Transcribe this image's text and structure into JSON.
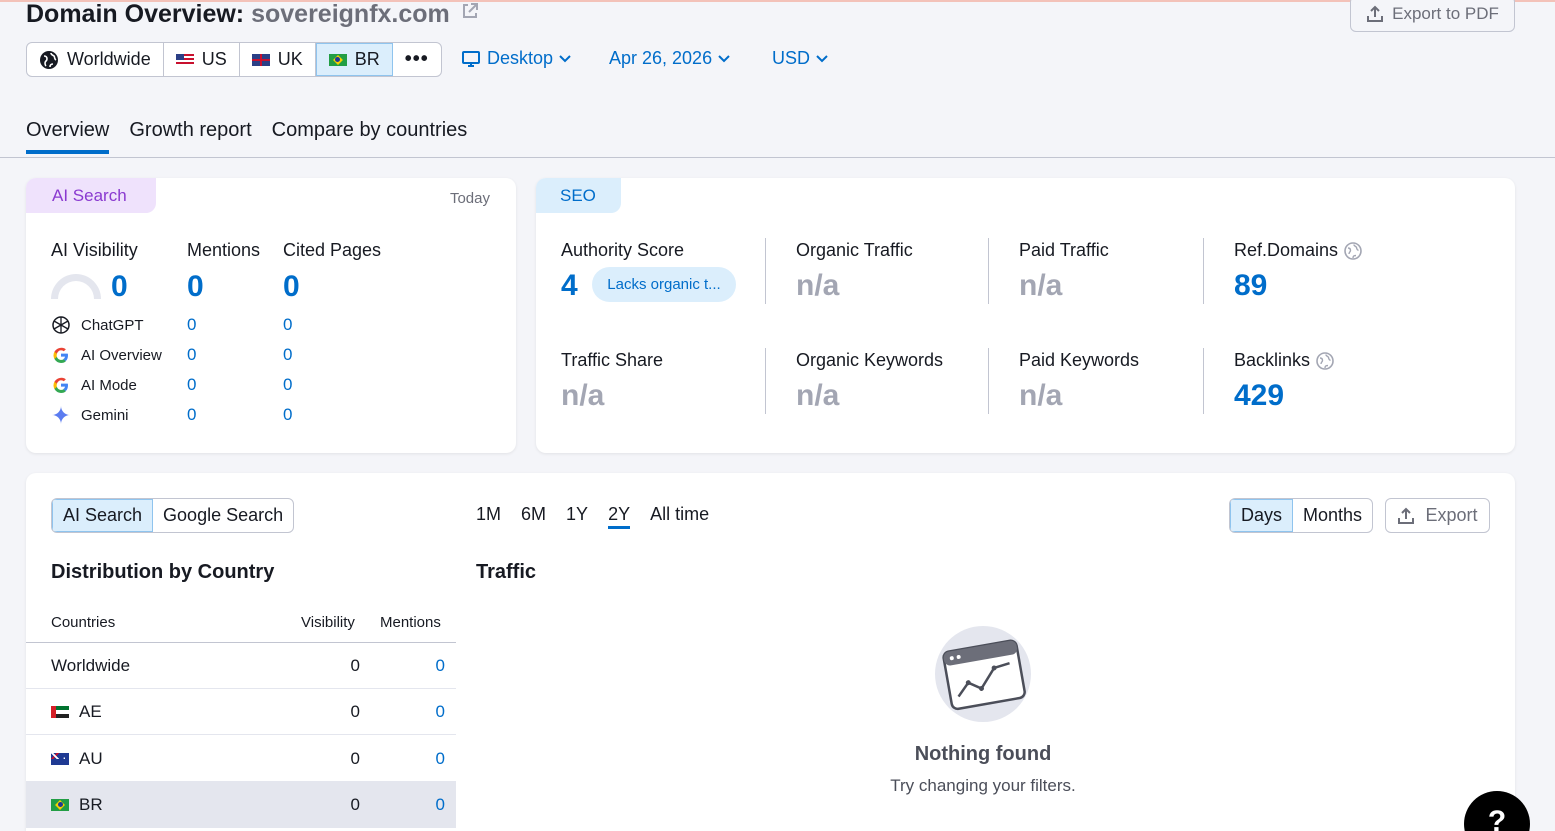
{
  "header": {
    "title_prefix": "Domain Overview:",
    "domain": "sovereignfx.com",
    "export_pdf_label": "Export to PDF"
  },
  "countries": [
    {
      "label": "Worldwide",
      "icon": "globe-icon"
    },
    {
      "label": "US",
      "icon": "flag-us"
    },
    {
      "label": "UK",
      "icon": "flag-uk"
    },
    {
      "label": "BR",
      "icon": "flag-br",
      "selected": true
    }
  ],
  "more_label": "•••",
  "filters": {
    "device": "Desktop",
    "date": "Apr 26, 2026",
    "currency": "USD"
  },
  "tabs": [
    {
      "label": "Overview",
      "active": true
    },
    {
      "label": "Growth report"
    },
    {
      "label": "Compare by countries"
    }
  ],
  "ai_search": {
    "badge": "AI Search",
    "date_label": "Today",
    "headers": {
      "visibility": "AI Visibility",
      "mentions": "Mentions",
      "cited": "Cited Pages"
    },
    "totals": {
      "visibility": "0",
      "mentions": "0",
      "cited": "0"
    },
    "platforms": [
      {
        "name": "ChatGPT",
        "icon": "chatgpt-icon",
        "mentions": "0",
        "cited": "0"
      },
      {
        "name": "AI Overview",
        "icon": "google-icon",
        "mentions": "0",
        "cited": "0"
      },
      {
        "name": "AI Mode",
        "icon": "google-icon",
        "mentions": "0",
        "cited": "0"
      },
      {
        "name": "Gemini",
        "icon": "gemini-icon",
        "mentions": "0",
        "cited": "0"
      }
    ]
  },
  "seo": {
    "badge": "SEO",
    "authority_score": {
      "label": "Authority Score",
      "value": "4",
      "note": "Lacks organic t..."
    },
    "organic_traffic": {
      "label": "Organic Traffic",
      "value": "n/a"
    },
    "paid_traffic": {
      "label": "Paid Traffic",
      "value": "n/a"
    },
    "ref_domains": {
      "label": "Ref.Domains",
      "value": "89"
    },
    "traffic_share": {
      "label": "Traffic Share",
      "value": "n/a"
    },
    "organic_keywords": {
      "label": "Organic Keywords",
      "value": "n/a"
    },
    "paid_keywords": {
      "label": "Paid Keywords",
      "value": "n/a"
    },
    "backlinks": {
      "label": "Backlinks",
      "value": "429"
    }
  },
  "bottom": {
    "source_toggle": [
      {
        "label": "AI Search",
        "active": true
      },
      {
        "label": "Google Search"
      }
    ],
    "periods": [
      {
        "label": "1M"
      },
      {
        "label": "6M"
      },
      {
        "label": "1Y"
      },
      {
        "label": "2Y",
        "active": true
      },
      {
        "label": "All time"
      }
    ],
    "granularity": [
      {
        "label": "Days",
        "active": true
      },
      {
        "label": "Months"
      }
    ],
    "export_label": "Export",
    "distribution_title": "Distribution by Country",
    "table_headers": {
      "countries": "Countries",
      "visibility": "Visibility",
      "mentions": "Mentions"
    },
    "rows": [
      {
        "country": "Worldwide",
        "flag": "",
        "visibility": "0",
        "mentions": "0"
      },
      {
        "country": "AE",
        "flag": "flag-ae",
        "visibility": "0",
        "mentions": "0"
      },
      {
        "country": "AU",
        "flag": "flag-au",
        "visibility": "0",
        "mentions": "0"
      },
      {
        "country": "BR",
        "flag": "flag-br",
        "visibility": "0",
        "mentions": "0",
        "selected": true
      }
    ],
    "traffic_title": "Traffic",
    "empty_title": "Nothing found",
    "empty_subtitle": "Try changing your filters."
  },
  "help_label": "?"
}
